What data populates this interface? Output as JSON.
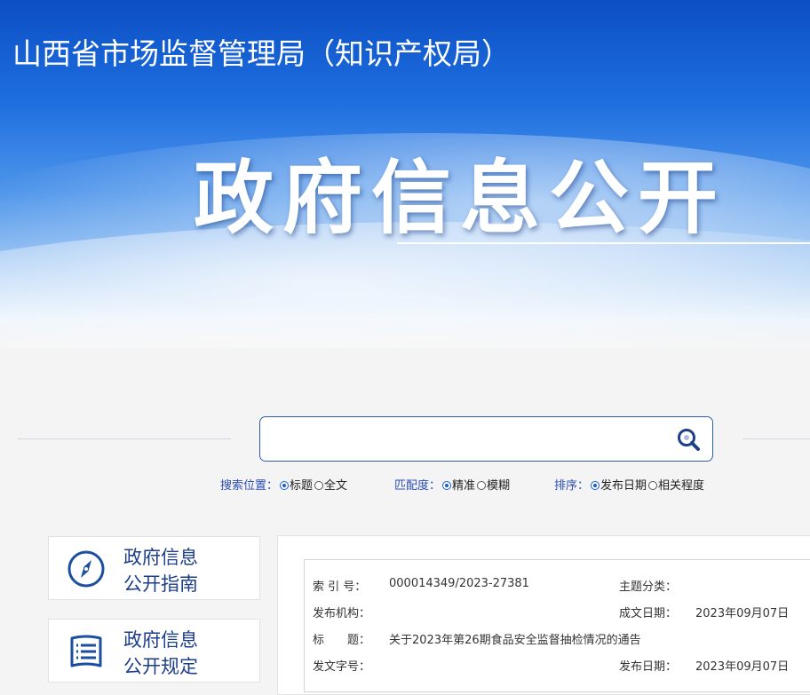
{
  "header": {
    "agency_name": "山西省市场监督管理局（知识产权局）",
    "section_title": "政府信息公开"
  },
  "search": {
    "value": "",
    "placeholder": "",
    "icon": "search-icon"
  },
  "search_options": {
    "position": {
      "label": "搜索位置：",
      "options": [
        "标题",
        "全文"
      ],
      "selected": "标题"
    },
    "match": {
      "label": "匹配度：",
      "options": [
        "精准",
        "模糊"
      ],
      "selected": "精准"
    },
    "sort": {
      "label": "排序：",
      "options": [
        "发布日期",
        "相关程度"
      ],
      "selected": "发布日期"
    }
  },
  "sidebar": {
    "items": [
      {
        "line1": "政府信息",
        "line2": "公开指南",
        "icon": "compass-icon"
      },
      {
        "line1": "政府信息",
        "line2": "公开规定",
        "icon": "document-list-icon"
      }
    ]
  },
  "document_meta": {
    "index_label": "索 引 号：",
    "index_value": "000014349/2023-27381",
    "topic_label": "主题分类：",
    "topic_value": "",
    "issuer_label": "发布机构：",
    "issuer_value": "",
    "created_label": "成文日期：",
    "created_value": "2023年09月07日",
    "title_label": "标　　题：",
    "title_value": "关于2023年第26期食品安全监督抽检情况的通告",
    "docno_label": "发文字号：",
    "docno_value": "",
    "published_label": "发布日期：",
    "published_value": "2023年09月07日"
  },
  "colors": {
    "banner_blue": "#0b4fc3",
    "accent_text": "#2a4db5",
    "nav_text": "#1d3f8a",
    "search_border": "#2d5fa7"
  }
}
